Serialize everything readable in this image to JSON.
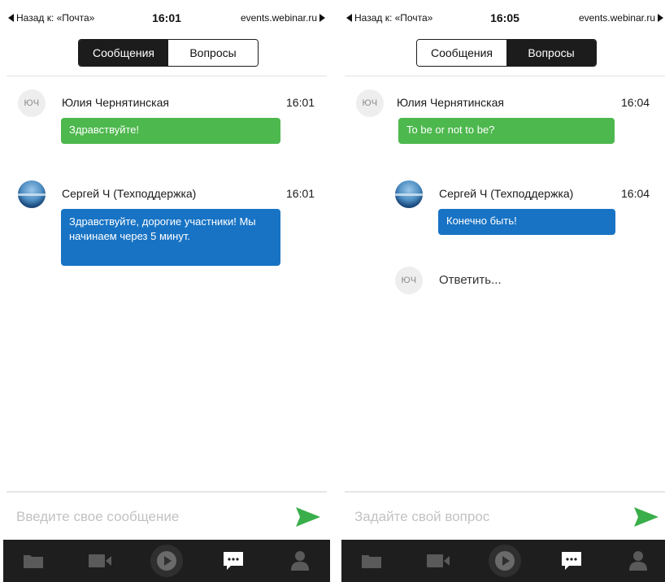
{
  "colors": {
    "green_bubble": "#4db84d",
    "blue_bubble": "#1873c4",
    "tabbar": "#1e1e1e",
    "send": "#3aae4a"
  },
  "screens": [
    {
      "status": {
        "back": "Назад к: «Почта»",
        "time": "16:01",
        "url": "events.webinar.ru"
      },
      "tabs": [
        "Сообщения",
        "Вопросы"
      ],
      "active_tab": 0,
      "messages": [
        {
          "avatar": "ЮЧ",
          "author": "Юлия Чернятинская",
          "time": "16:01",
          "text": "Здравствуйте!"
        },
        {
          "avatar": "",
          "author": "Сергей Ч (Техподдержка)",
          "time": "16:01",
          "text": "Здравствуйте, дорогие участники! Мы начинаем через 5 минут."
        }
      ],
      "composer": {
        "placeholder": "Введите свое сообщение"
      },
      "bottom_icons": [
        "folder-icon",
        "video-camera-icon",
        "play-icon",
        "chat-icon",
        "user-icon"
      ]
    },
    {
      "status": {
        "back": "Назад к: «Почта»",
        "time": "16:05",
        "url": "events.webinar.ru"
      },
      "tabs": [
        "Сообщения",
        "Вопросы"
      ],
      "active_tab": 1,
      "question": {
        "avatar": "ЮЧ",
        "author": "Юлия Чернятинская",
        "time": "16:04",
        "text": "To be or not to be?"
      },
      "answer": {
        "avatar": "",
        "author": "Сергей Ч (Техподдержка)",
        "time": "16:04",
        "text": "Конечно быть!"
      },
      "reply": {
        "avatar": "ЮЧ",
        "label": "Ответить..."
      },
      "composer": {
        "placeholder": "Задайте свой вопрос"
      },
      "bottom_icons": [
        "folder-icon",
        "video-camera-icon",
        "play-icon",
        "chat-icon",
        "user-icon"
      ]
    }
  ]
}
